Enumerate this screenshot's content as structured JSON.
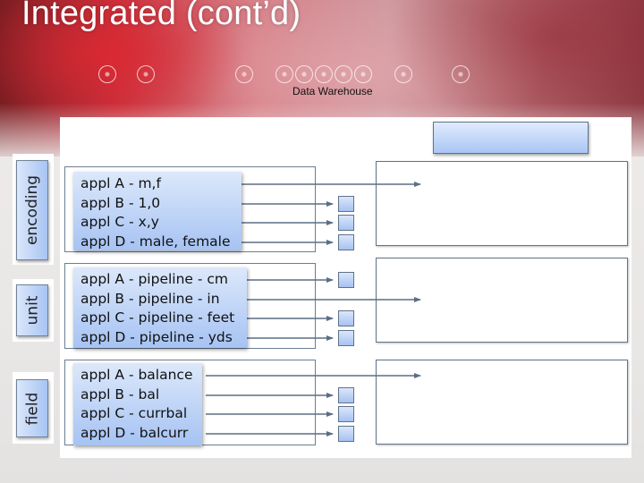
{
  "slide": {
    "title": "Integrated (cont’d)",
    "data_warehouse_label": "Data Warehouse"
  },
  "groups": [
    {
      "category": "encoding",
      "items": [
        "appl A - m,f",
        "appl B - 1,0",
        "appl C - x,y",
        "appl D - male, female"
      ],
      "targets": [
        "warehouse",
        "square",
        "square",
        "square"
      ]
    },
    {
      "category": "unit",
      "items": [
        "appl A - pipeline - cm",
        "appl B - pipeline - in",
        "appl C - pipeline - feet",
        "appl D - pipeline - yds"
      ],
      "targets": [
        "square",
        "warehouse",
        "square",
        "square"
      ]
    },
    {
      "category": "field",
      "items": [
        "appl A - balance",
        "appl B - bal",
        "appl C - currbal",
        "appl D - balcurr"
      ],
      "targets": [
        "warehouse",
        "square",
        "square",
        "square"
      ]
    }
  ],
  "colors": {
    "box_fill_top": "#dce8fb",
    "box_fill_bottom": "#a6c3f3",
    "border": "#5f7388",
    "arrow": "#5b6e84",
    "title_text": "#ffffff"
  }
}
